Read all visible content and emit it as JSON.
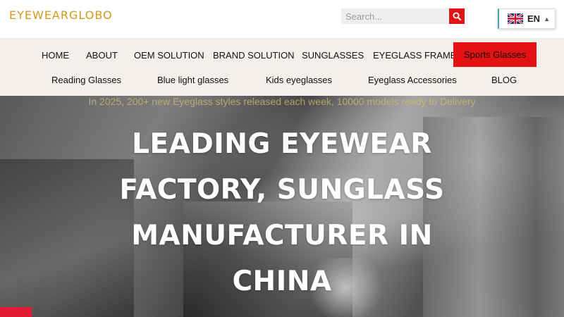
{
  "brand": {
    "logo_text": "EYEWEARGLOBO",
    "logo_color": "#d39a1c"
  },
  "search": {
    "placeholder": "Search...",
    "icon": "search-icon"
  },
  "language": {
    "label": "EN",
    "flag": "uk-flag-icon",
    "caret": "chevron-up-icon"
  },
  "nav": {
    "row1": [
      "HOME",
      "ABOUT",
      "OEM SOLUTION",
      "BRAND SOLUTION",
      "SUNGLASSES",
      "EYEGLASS FRAMES",
      "Sports Glasses"
    ],
    "row2": [
      "Reading Glasses",
      "Blue light glasses",
      "Kids eyeglasses",
      "Eyeglass Accessories",
      "BLOG"
    ],
    "active": "Sports Glasses"
  },
  "hero": {
    "ticker": "In 2025, 200+ new Eyeglass styles released each week, 10000 models ready to Delivery",
    "title": "LEADING EYEWEAR FACTORY, SUNGLASS MANUFACTURER IN CHINA"
  },
  "colors": {
    "accent_red": "#e41212",
    "nav_bg": "#f3f0ec",
    "search_bg": "#eeeeee"
  }
}
